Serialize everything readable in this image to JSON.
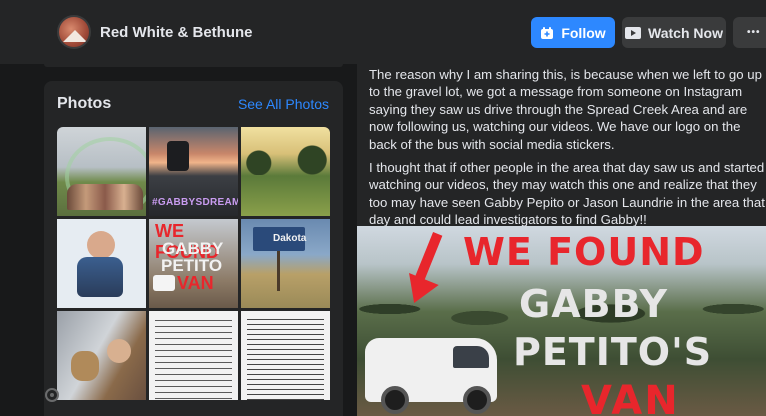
{
  "header": {
    "page_name": "Red White & Bethune",
    "follow_label": "Follow",
    "watch_label": "Watch Now",
    "more_label": "•••",
    "colors": {
      "bar": "#242526",
      "follow": "#2d88ff",
      "secondary": "#3a3b3c"
    }
  },
  "photos": {
    "title": "Photos",
    "see_all": "See All Photos",
    "items": [
      {
        "label": ""
      },
      {
        "label": "#GABBYSDREAM"
      },
      {
        "label": ""
      },
      {
        "label": ""
      },
      {
        "label_lines": [
          "WE FOUND",
          "GABBY",
          "PETITO",
          "VAN"
        ]
      },
      {
        "label": "Dakota"
      },
      {
        "label": ""
      },
      {
        "label": ""
      },
      {
        "label": ""
      }
    ]
  },
  "post": {
    "paragraphs": [
      "The reason why I am sharing this, is because when we left to go up to the gravel lot, we got a message from someone on Instagram saying they saw us drive through the Spread Creek Area and are now following us, watching our videos. We have our logo on the back of the bus with social media stickers.",
      "I thought that if other people in the area that day saw us and started watching our videos, they may watch this one and realize that they too may have seen Gabby Pepito or Jason Laundrie in the area that day and could lead investigators to find Gabby!!"
    ],
    "thumbnail": {
      "line1": "WE FOUND",
      "line2": "GABBY",
      "line3": "PETITO'S",
      "line4": "VAN"
    }
  }
}
